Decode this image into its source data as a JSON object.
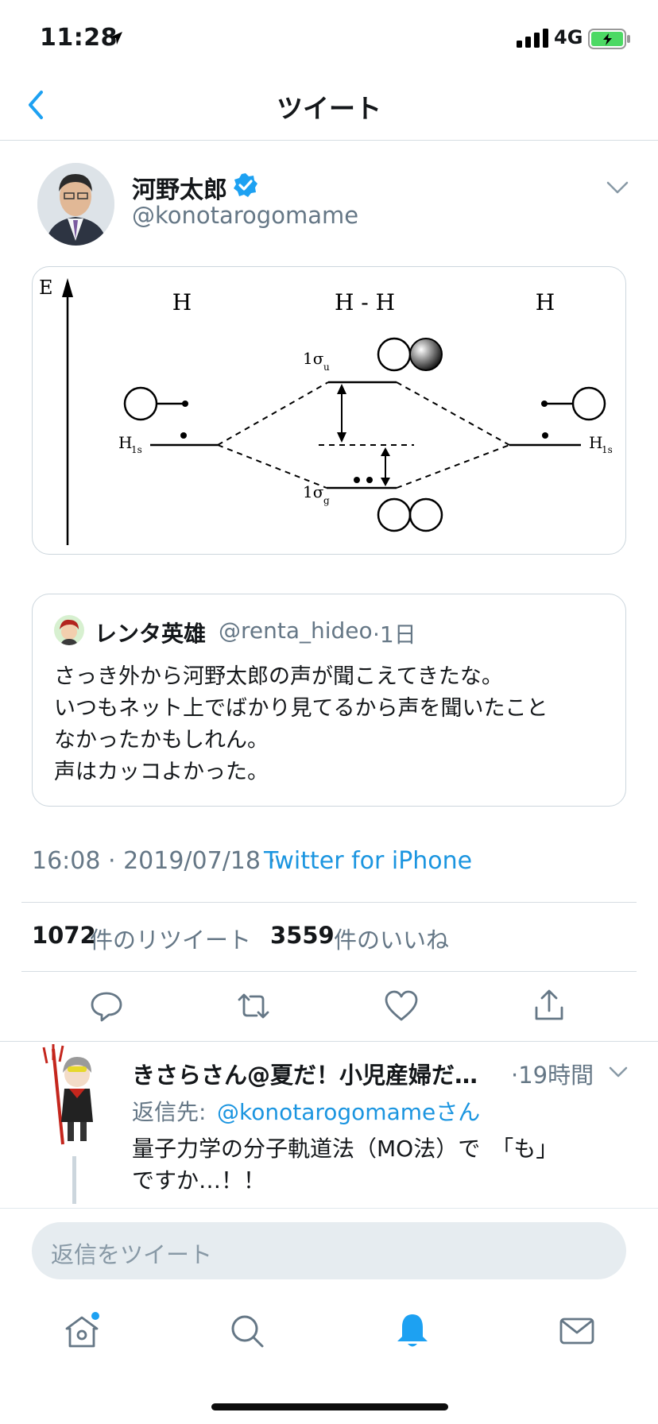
{
  "status_bar": {
    "time": "11:28",
    "network": "4G",
    "battery_color": "#4cd964"
  },
  "nav": {
    "title": "ツイート",
    "back_icon": "chevron-left-icon"
  },
  "tweet": {
    "author": {
      "name": "河野太郎",
      "handle": "@konotarogomame",
      "verified": true
    },
    "diagram": {
      "axis_label": "E",
      "left_header": "H",
      "center_header": "H - H",
      "right_header": "H",
      "left_level_label": "H",
      "left_level_sub": "1s",
      "right_level_label": "H",
      "right_level_sub": "1s",
      "upper_level_label": "1σ",
      "upper_level_sub": "u",
      "lower_level_label": "1σ",
      "lower_level_sub": "g"
    },
    "quote": {
      "name": "レンタ英雄",
      "handle": "@renta_hideo",
      "time": "·1日",
      "lines": [
        "さっき外から河野太郎の声が聞こえてきたな。",
        "いつもネット上でばかり見てるから声を聞いたこと",
        "なかったかもしれん。",
        "声はカッコよかった。"
      ]
    },
    "timestamp": "16:08 · 2019/07/18 ·",
    "source": "Twitter for iPhone",
    "retweet_count": "1072",
    "retweet_label": "件のリツイート",
    "like_count": "3559",
    "like_label": "件のいいね"
  },
  "reply": {
    "name": "きさらさん@夏だ！小児産婦だ…",
    "time": "·19時間",
    "reply_to_label": "返信先:",
    "reply_to_user": "@konotarogomameさん",
    "lines": [
      "量子力学の分子軌道法（MO法）で　「も」",
      "ですか…！！"
    ]
  },
  "composer": {
    "placeholder": "返信をツイート"
  },
  "colors": {
    "accent": "#1da1f2",
    "link": "#1b95e0",
    "secondary_text": "#657786",
    "border": "#ccd6dd"
  }
}
